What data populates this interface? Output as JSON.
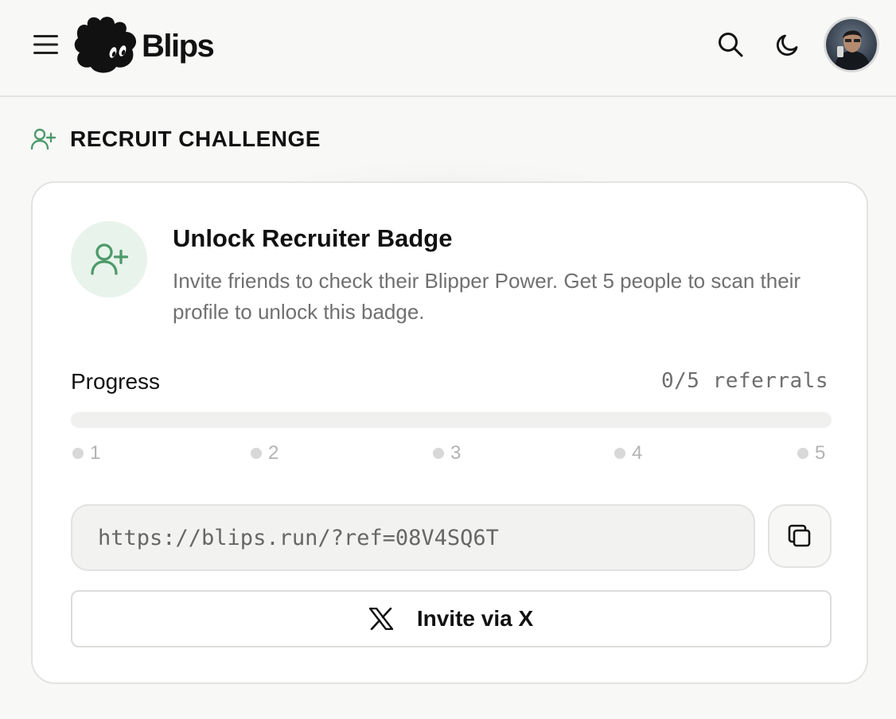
{
  "app": {
    "name": "Blips"
  },
  "header": {
    "menu_icon": "hamburger-icon",
    "search_icon": "search-icon",
    "theme_icon": "moon-icon",
    "avatar": "user-avatar"
  },
  "section": {
    "title": "RECRUIT CHALLENGE",
    "icon": "user-plus-icon"
  },
  "card": {
    "title": "Unlock Recruiter Badge",
    "description": "Invite friends to check their Blipper Power. Get 5 people to scan their profile to unlock this badge.",
    "progress_label": "Progress",
    "progress_count": "0/5 referrals",
    "progress_fraction": 0,
    "steps": [
      "1",
      "2",
      "3",
      "4",
      "5"
    ],
    "referral_link": "https://blips.run/?ref=08V4SQ6T",
    "copy_icon": "copy-icon",
    "invite_button": "Invite via X",
    "invite_icon": "x-logo-icon"
  },
  "colors": {
    "accent_green": "#5fa577",
    "badge_bg": "#e8f3ec",
    "muted_text": "#707070"
  }
}
